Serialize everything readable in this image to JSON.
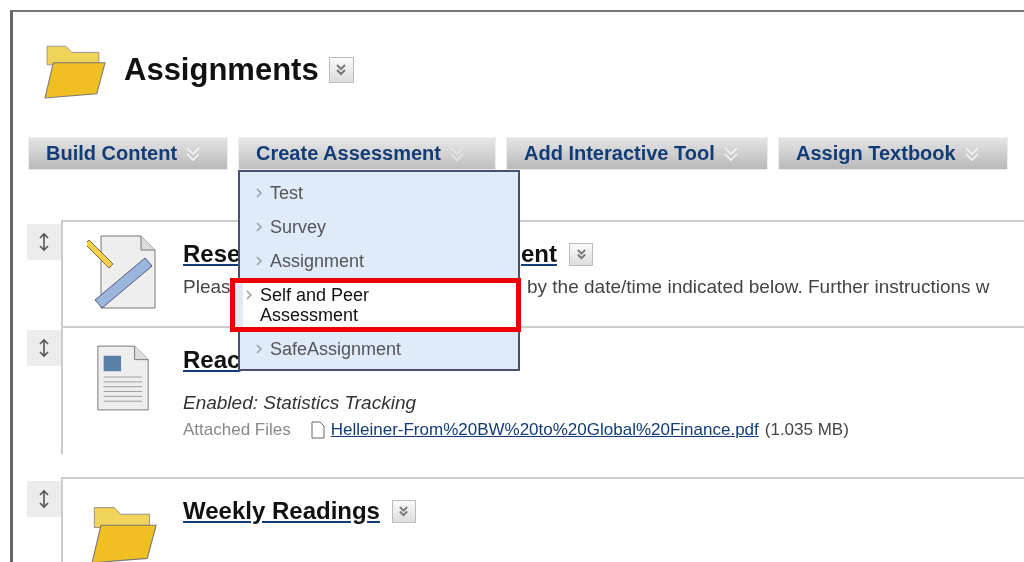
{
  "page": {
    "title": "Assignments"
  },
  "toolbar": [
    {
      "label": "Build Content",
      "expanded": false
    },
    {
      "label": "Create Assessment",
      "expanded": true
    },
    {
      "label": "Add Interactive Tool",
      "expanded": false
    },
    {
      "label": "Assign Textbook",
      "expanded": false
    }
  ],
  "menu": [
    {
      "label": "Test",
      "selected": false
    },
    {
      "label": "Survey",
      "selected": false
    },
    {
      "label": "Assignment",
      "selected": false
    },
    {
      "label": "Self and Peer Assessment",
      "selected": true
    },
    {
      "label": "SafeAssignment",
      "selected": false
    }
  ],
  "content_items": [
    {
      "kind": "assignment",
      "title_parts": [
        "Rese",
        "ent"
      ],
      "has_menu": true,
      "description_parts": [
        "Pleas",
        "by the date/time indicated below. Further instructions w"
      ]
    },
    {
      "kind": "document",
      "title_parts": [
        "Reac"
      ],
      "has_menu": false,
      "status": "Enabled: Statistics Tracking",
      "attachment_label": "Attached Files",
      "attachment_file": "Helleiner-From%20BW%20to%20Global%20Finance.pdf",
      "attachment_size": "(1.035 MB)"
    },
    {
      "kind": "folder",
      "title_parts": [
        "Weekly Readings"
      ],
      "has_menu": true
    }
  ]
}
